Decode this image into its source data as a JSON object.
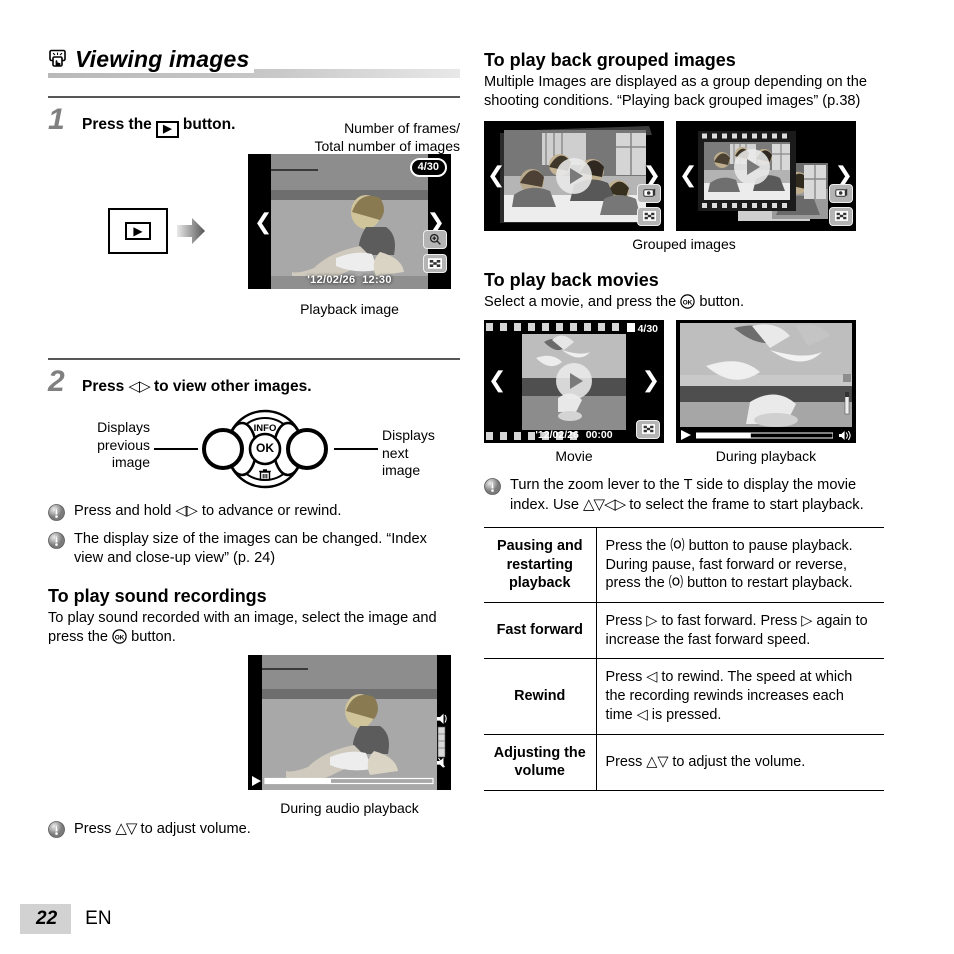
{
  "section": {
    "icon": "playback-screen-icon",
    "title": "Viewing images"
  },
  "steps": [
    {
      "number": "1",
      "text_before": "Press the",
      "button_glyph": "▶",
      "text_after": "button."
    },
    {
      "number": "2",
      "text_before": "Press",
      "glyph": "◁▷",
      "text_after": "to view other images."
    }
  ],
  "step1": {
    "callout_line1": "Number of frames/",
    "callout_line2": "Total number of images",
    "button_label": "▶",
    "screen": {
      "frame_counter": "4/30",
      "date": "'12/02/26",
      "time": "12:30",
      "icon_magnify": "magnify-icon",
      "icon_index": "index-view-icon"
    },
    "caption": "Playback image"
  },
  "step2": {
    "label_left_line1": "Displays",
    "label_left_line2": "previous",
    "label_left_line3": "image",
    "label_right_line1": "Displays next",
    "label_right_line2": "image",
    "pad_info": "INFO",
    "pad_ok": "OK",
    "pad_trash": "trash-icon"
  },
  "left_notes": [
    "Press and hold ◁▷ to advance or rewind.",
    "The display size of the images can be changed. “Index view and close-up view” (p. 24)"
  ],
  "sound_section": {
    "heading": "To play sound recordings",
    "body_before": "To play sound recorded with an image, select the image and press the",
    "body_after": "button.",
    "caption": "During audio playback"
  },
  "bottom_note": {
    "text_before": "Press",
    "glyph": "△▽",
    "text_after": "to adjust volume."
  },
  "grouped_section": {
    "heading": "To play back grouped images",
    "body": "Multiple Images are displayed as a group depending on the shooting conditions. “Playing back grouped images” (p.38)",
    "caption": "Grouped images"
  },
  "movies_section": {
    "heading": "To play back movies",
    "body_before": "Select a movie, and press the",
    "body_after": "button.",
    "screen": {
      "frame_counter": "4/30",
      "date": "'12/02/26",
      "time": "00:00"
    },
    "caption_left": "Movie",
    "caption_right": "During playback",
    "note_before": "Turn the zoom lever to the T side to display the movie index. Use",
    "note_glyphs": "△▽◁▷",
    "note_after": "to select the frame to start playback."
  },
  "ops_table": {
    "rows": [
      {
        "label": "Pausing and restarting playback",
        "desc": "Press the ⒪ button to pause playback. During pause, fast forward or reverse, press the ⒪ button to restart playback."
      },
      {
        "label": "Fast forward",
        "desc": "Press ▷ to fast forward. Press ▷ again to increase the fast forward speed."
      },
      {
        "label": "Rewind",
        "desc": "Press ◁ to rewind. The speed at which the recording rewinds increases each time ◁ is pressed."
      },
      {
        "label": "Adjusting the volume",
        "desc": "Press △▽ to adjust the volume."
      }
    ]
  },
  "footer": {
    "page_number": "22",
    "language": "EN"
  },
  "colors": {
    "step_number": "#808080",
    "band": "#c0c0c0",
    "page_badge": "#d2d2d2"
  }
}
